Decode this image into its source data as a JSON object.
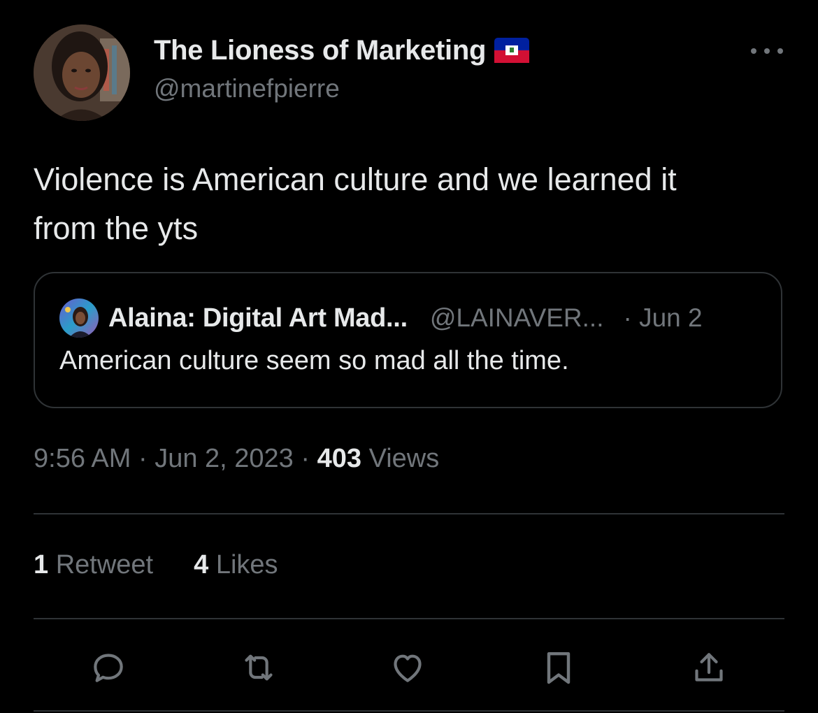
{
  "author": {
    "display_name": "The Lioness of Marketing",
    "handle": "@martinefpierre",
    "flag_icon": "haiti-flag-icon"
  },
  "tweet": {
    "text": "Violence is American culture and we learned it\nfrom the yts"
  },
  "quote": {
    "display_name": "Alaina: Digital Art Mad...",
    "handle": "@LAINAVER...",
    "date": "· Jun 2",
    "text": "American culture seem so mad all the time."
  },
  "meta": {
    "time": "9:56 AM",
    "separator": "·",
    "date": "Jun 2, 2023",
    "views_count": "403",
    "views_label": "Views"
  },
  "stats": {
    "retweets_count": "1",
    "retweets_label": "Retweet",
    "likes_count": "4",
    "likes_label": "Likes"
  },
  "actions": [
    "reply-icon",
    "retweet-icon",
    "like-icon",
    "bookmark-icon",
    "share-icon"
  ],
  "colors": {
    "background": "#000000",
    "primary_text": "#e7e9ea",
    "secondary_text": "#71767b",
    "border": "#2f3336"
  }
}
